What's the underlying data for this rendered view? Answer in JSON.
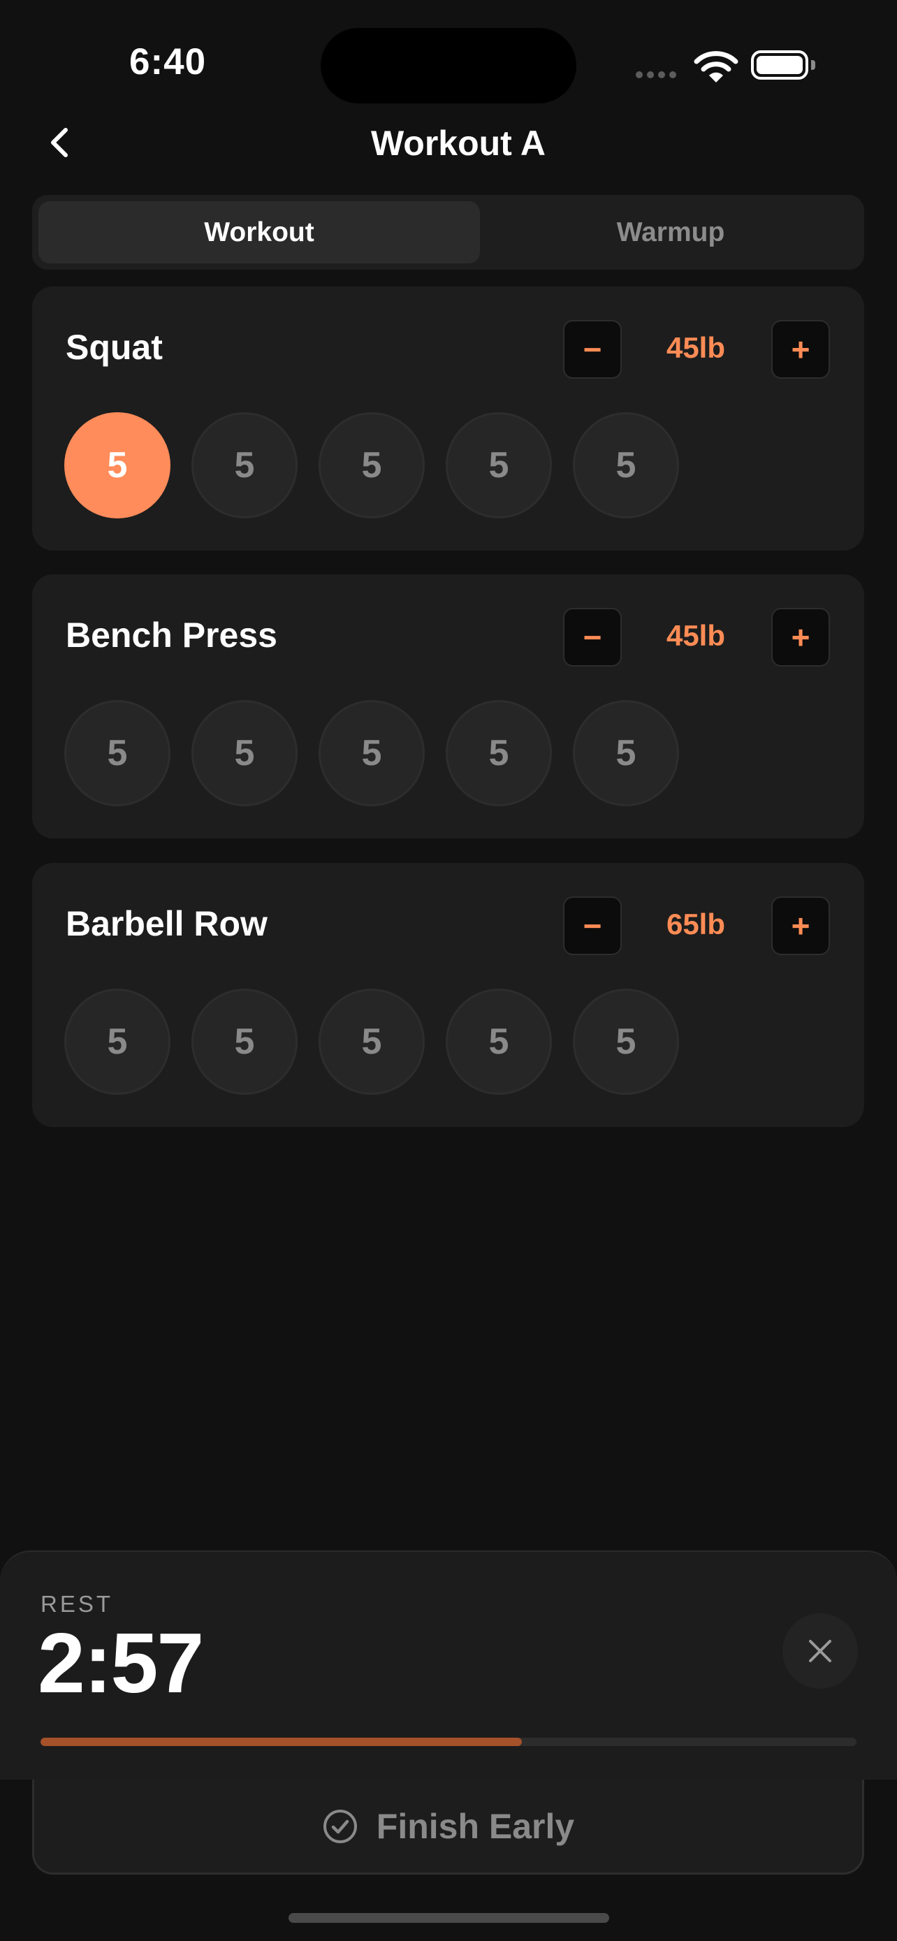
{
  "status_bar": {
    "time": "6:40"
  },
  "nav": {
    "title": "Workout A"
  },
  "tabs": [
    {
      "label": "Workout",
      "active": true
    },
    {
      "label": "Warmup",
      "active": false
    }
  ],
  "exercises": [
    {
      "name": "Squat",
      "weight": "45lb",
      "sets": [
        "5",
        "5",
        "5",
        "5",
        "5"
      ],
      "completed_sets": 1
    },
    {
      "name": "Bench Press",
      "weight": "45lb",
      "sets": [
        "5",
        "5",
        "5",
        "5",
        "5"
      ],
      "completed_sets": 0
    },
    {
      "name": "Barbell Row",
      "weight": "65lb",
      "sets": [
        "5",
        "5",
        "5",
        "5",
        "5"
      ],
      "completed_sets": 0
    }
  ],
  "controls": {
    "minus_label": "−",
    "plus_label": "+"
  },
  "rest_timer": {
    "label": "REST",
    "time": "2:57",
    "progress": 0.59
  },
  "finish_button": {
    "label": "Finish Early"
  },
  "colors": {
    "accent": "#ff8c5a",
    "background": "#111111",
    "card": "#1d1d1d"
  }
}
